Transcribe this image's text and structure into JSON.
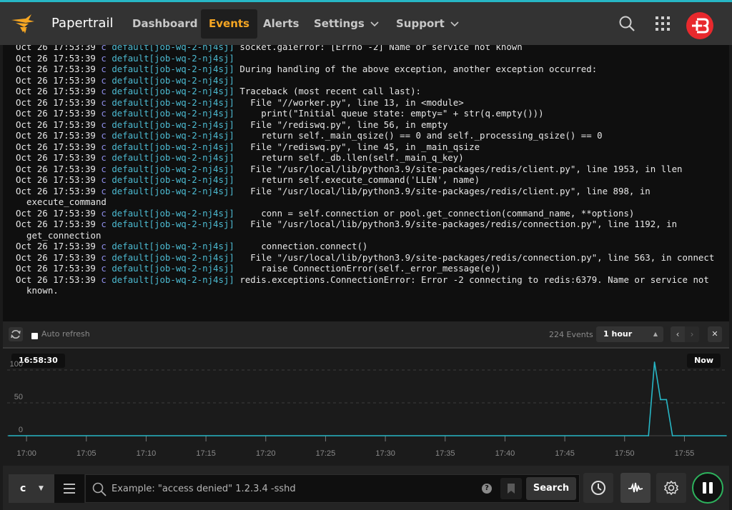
{
  "nav": {
    "brand": "Papertrail",
    "items": [
      {
        "label": "Dashboard",
        "active": false
      },
      {
        "label": "Events",
        "active": true
      },
      {
        "label": "Alerts",
        "active": false
      },
      {
        "label": "Settings",
        "dropdown": true
      },
      {
        "label": "Support",
        "dropdown": true
      }
    ],
    "icons": [
      "search-icon",
      "apps-grid-icon",
      "user-avatar"
    ],
    "accent_color": "#f5a623",
    "stripe_color": "#27b7c6"
  },
  "log": {
    "colors": {
      "timestamp": "#e8e8e8",
      "program": "#8c8ce6",
      "system": "#4cbad1"
    },
    "lines": [
      {
        "ts": "Oct 26 17:53:39",
        "prog": "c",
        "sys": "default[job-wq-2-nj4sj]",
        "msg": "socket.gaierror: [Errno -2] Name or service not known"
      },
      {
        "ts": "Oct 26 17:53:39",
        "prog": "c",
        "sys": "default[job-wq-2-nj4sj]",
        "msg": ""
      },
      {
        "ts": "Oct 26 17:53:39",
        "prog": "c",
        "sys": "default[job-wq-2-nj4sj]",
        "msg": "During handling of the above exception, another exception occurred:"
      },
      {
        "ts": "Oct 26 17:53:39",
        "prog": "c",
        "sys": "default[job-wq-2-nj4sj]",
        "msg": ""
      },
      {
        "ts": "Oct 26 17:53:39",
        "prog": "c",
        "sys": "default[job-wq-2-nj4sj]",
        "msg": "Traceback (most recent call last):"
      },
      {
        "ts": "Oct 26 17:53:39",
        "prog": "c",
        "sys": "default[job-wq-2-nj4sj]",
        "msg": "  File \"//worker.py\", line 13, in <module>"
      },
      {
        "ts": "Oct 26 17:53:39",
        "prog": "c",
        "sys": "default[job-wq-2-nj4sj]",
        "msg": "    print(\"Initial queue state: empty=\" + str(q.empty()))"
      },
      {
        "ts": "Oct 26 17:53:39",
        "prog": "c",
        "sys": "default[job-wq-2-nj4sj]",
        "msg": "  File \"/rediswq.py\", line 56, in empty"
      },
      {
        "ts": "Oct 26 17:53:39",
        "prog": "c",
        "sys": "default[job-wq-2-nj4sj]",
        "msg": "    return self._main_qsize() == 0 and self._processing_qsize() == 0"
      },
      {
        "ts": "Oct 26 17:53:39",
        "prog": "c",
        "sys": "default[job-wq-2-nj4sj]",
        "msg": "  File \"/rediswq.py\", line 45, in _main_qsize"
      },
      {
        "ts": "Oct 26 17:53:39",
        "prog": "c",
        "sys": "default[job-wq-2-nj4sj]",
        "msg": "    return self._db.llen(self._main_q_key)"
      },
      {
        "ts": "Oct 26 17:53:39",
        "prog": "c",
        "sys": "default[job-wq-2-nj4sj]",
        "msg": "  File \"/usr/local/lib/python3.9/site-packages/redis/client.py\", line 1953, in llen"
      },
      {
        "ts": "Oct 26 17:53:39",
        "prog": "c",
        "sys": "default[job-wq-2-nj4sj]",
        "msg": "    return self.execute_command('LLEN', name)"
      },
      {
        "ts": "Oct 26 17:53:39",
        "prog": "c",
        "sys": "default[job-wq-2-nj4sj]",
        "msg": "  File \"/usr/local/lib/python3.9/site-packages/redis/client.py\", line 898, in execute_command"
      },
      {
        "ts": "Oct 26 17:53:39",
        "prog": "c",
        "sys": "default[job-wq-2-nj4sj]",
        "msg": "    conn = self.connection or pool.get_connection(command_name, **options)"
      },
      {
        "ts": "Oct 26 17:53:39",
        "prog": "c",
        "sys": "default[job-wq-2-nj4sj]",
        "msg": "  File \"/usr/local/lib/python3.9/site-packages/redis/connection.py\", line 1192, in get_connection"
      },
      {
        "ts": "Oct 26 17:53:39",
        "prog": "c",
        "sys": "default[job-wq-2-nj4sj]",
        "msg": "    connection.connect()"
      },
      {
        "ts": "Oct 26 17:53:39",
        "prog": "c",
        "sys": "default[job-wq-2-nj4sj]",
        "msg": "  File \"/usr/local/lib/python3.9/site-packages/redis/connection.py\", line 563, in connect"
      },
      {
        "ts": "Oct 26 17:53:39",
        "prog": "c",
        "sys": "default[job-wq-2-nj4sj]",
        "msg": "    raise ConnectionError(self._error_message(e))"
      },
      {
        "ts": "Oct 26 17:53:39",
        "prog": "c",
        "sys": "default[job-wq-2-nj4sj]",
        "msg": "redis.exceptions.ConnectionError: Error -2 connecting to redis:6379. Name or service not known."
      }
    ]
  },
  "toolbar": {
    "auto_refresh_label": "Auto refresh",
    "auto_refresh_checked": false,
    "event_count": "224 Events",
    "range_selected": "1 hour",
    "prev_label": "‹",
    "next_label": "›",
    "close_label": "✕"
  },
  "histogram": {
    "start_label": "16:58:30",
    "end_label": "Now",
    "line_color": "#27b7c6"
  },
  "chart_data": {
    "type": "line",
    "title": "",
    "xlabel": "",
    "ylabel": "",
    "ylim": [
      0,
      125
    ],
    "yticks": [
      0,
      50,
      100
    ],
    "xticks": [
      "17:00",
      "17:05",
      "17:10",
      "17:15",
      "17:20",
      "17:25",
      "17:30",
      "17:35",
      "17:40",
      "17:45",
      "17:50",
      "17:55"
    ],
    "x_range_minutes": [
      -1.5,
      58.5
    ],
    "grid": true,
    "series": [
      {
        "name": "events",
        "x_minutes": [
          -1.5,
          52.0,
          52.5,
          53.0,
          53.5,
          54.0,
          58.5
        ],
        "values": [
          0,
          0,
          112,
          55,
          55,
          0,
          0
        ]
      }
    ]
  },
  "bottombar": {
    "system_select": "c",
    "search_placeholder": "Example: \"access denied\" 1.2.3.4 -sshd",
    "search_value": "",
    "help_label": "?",
    "search_button": "Search",
    "pause_color": "#2db35d"
  }
}
